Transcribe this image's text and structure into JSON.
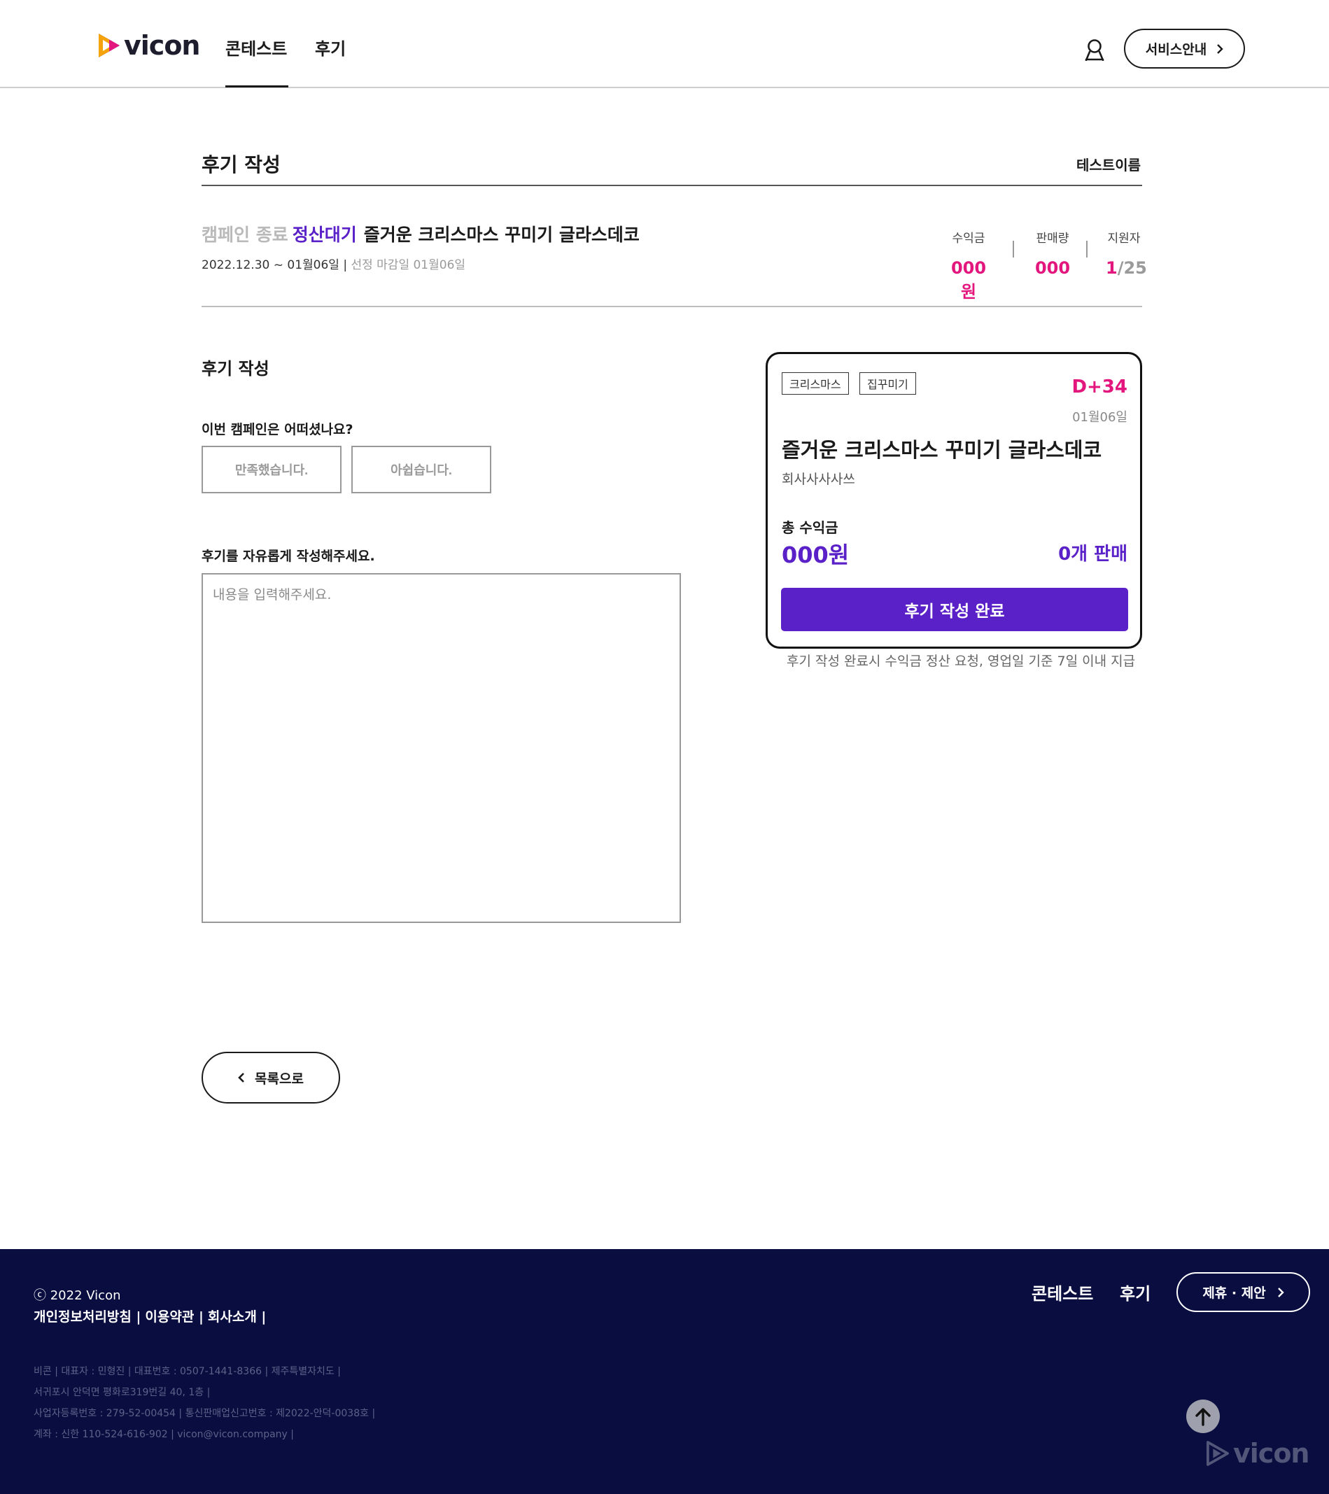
{
  "brand": {
    "name": "vicon"
  },
  "header": {
    "nav": [
      "콘테스트",
      "후기"
    ],
    "active_nav": "콘테스트",
    "service_button": "서비스안내"
  },
  "page": {
    "title": "후기 작성",
    "user_name": "테스트이름"
  },
  "campaign": {
    "status": "캠페인 종료",
    "substatus": "정산대기",
    "title": "즐거운 크리스마스 꾸미기 글라스데코",
    "period": "2022.12.30 ~ 01월06일",
    "selection_deadline": "선정 마감일 01월06일",
    "stats": [
      {
        "label": "수익금",
        "value": "000원"
      },
      {
        "label": "판매량",
        "value": "000"
      },
      {
        "label": "지원자",
        "value_current": "1",
        "value_total": "/25"
      }
    ]
  },
  "form": {
    "section_title": "후기 작성",
    "question_satisfaction": "이번 캠페인은 어떠셨나요?",
    "choices": [
      "만족했습니다.",
      "아쉽습니다."
    ],
    "question_review": "후기를 자유롭게 작성해주세요.",
    "review_placeholder": "내용을 입력해주세요."
  },
  "card": {
    "tags": [
      "크리스마스",
      "집꾸미기"
    ],
    "dday": "D+34",
    "date": "01월06일",
    "title": "즐거운 크리스마스 꾸미기 글라스데코",
    "company": "회사사사사쓰",
    "earnings_label": "총 수익금",
    "earnings_value": "000원",
    "sold": "0개 판매",
    "submit_label": "후기 작성 완료",
    "note": "후기 작성 완료시 수익금 정산 요청, 영업일 기준 7일 이내 지급"
  },
  "back_button": "목록으로",
  "footer": {
    "copyright": "ⓒ 2022 Vicon",
    "links": [
      "개인정보처리방침 |",
      "이용약관 |",
      "회사소개 |"
    ],
    "nav": [
      "콘테스트",
      "후기"
    ],
    "partner_button": "제휴 · 제안",
    "info_lines": [
      "비콘 | 대표자 : 민형진 | 대표번호 : 0507-1441-8366 | 제주특별자치도 |",
      "서귀포시 안덕면 평화로319번길 40, 1층 |",
      "사업자등록번호 : 279-52-00454 | 통신판매업신고번호 : 제2022-안덕-0038호 |",
      "계좌 : 신한 110-524-616-902 | vicon@vicon.company |"
    ]
  },
  "colors": {
    "accent_purple": "#5b21c9",
    "accent_pink": "#e3167d",
    "footer_bg": "#090d3f",
    "logo_orange": "#f5a30a"
  },
  "icons": [
    "vicon-logo-icon",
    "user-icon",
    "chevron-right-icon",
    "chevron-left-icon",
    "arrow-up-icon"
  ]
}
